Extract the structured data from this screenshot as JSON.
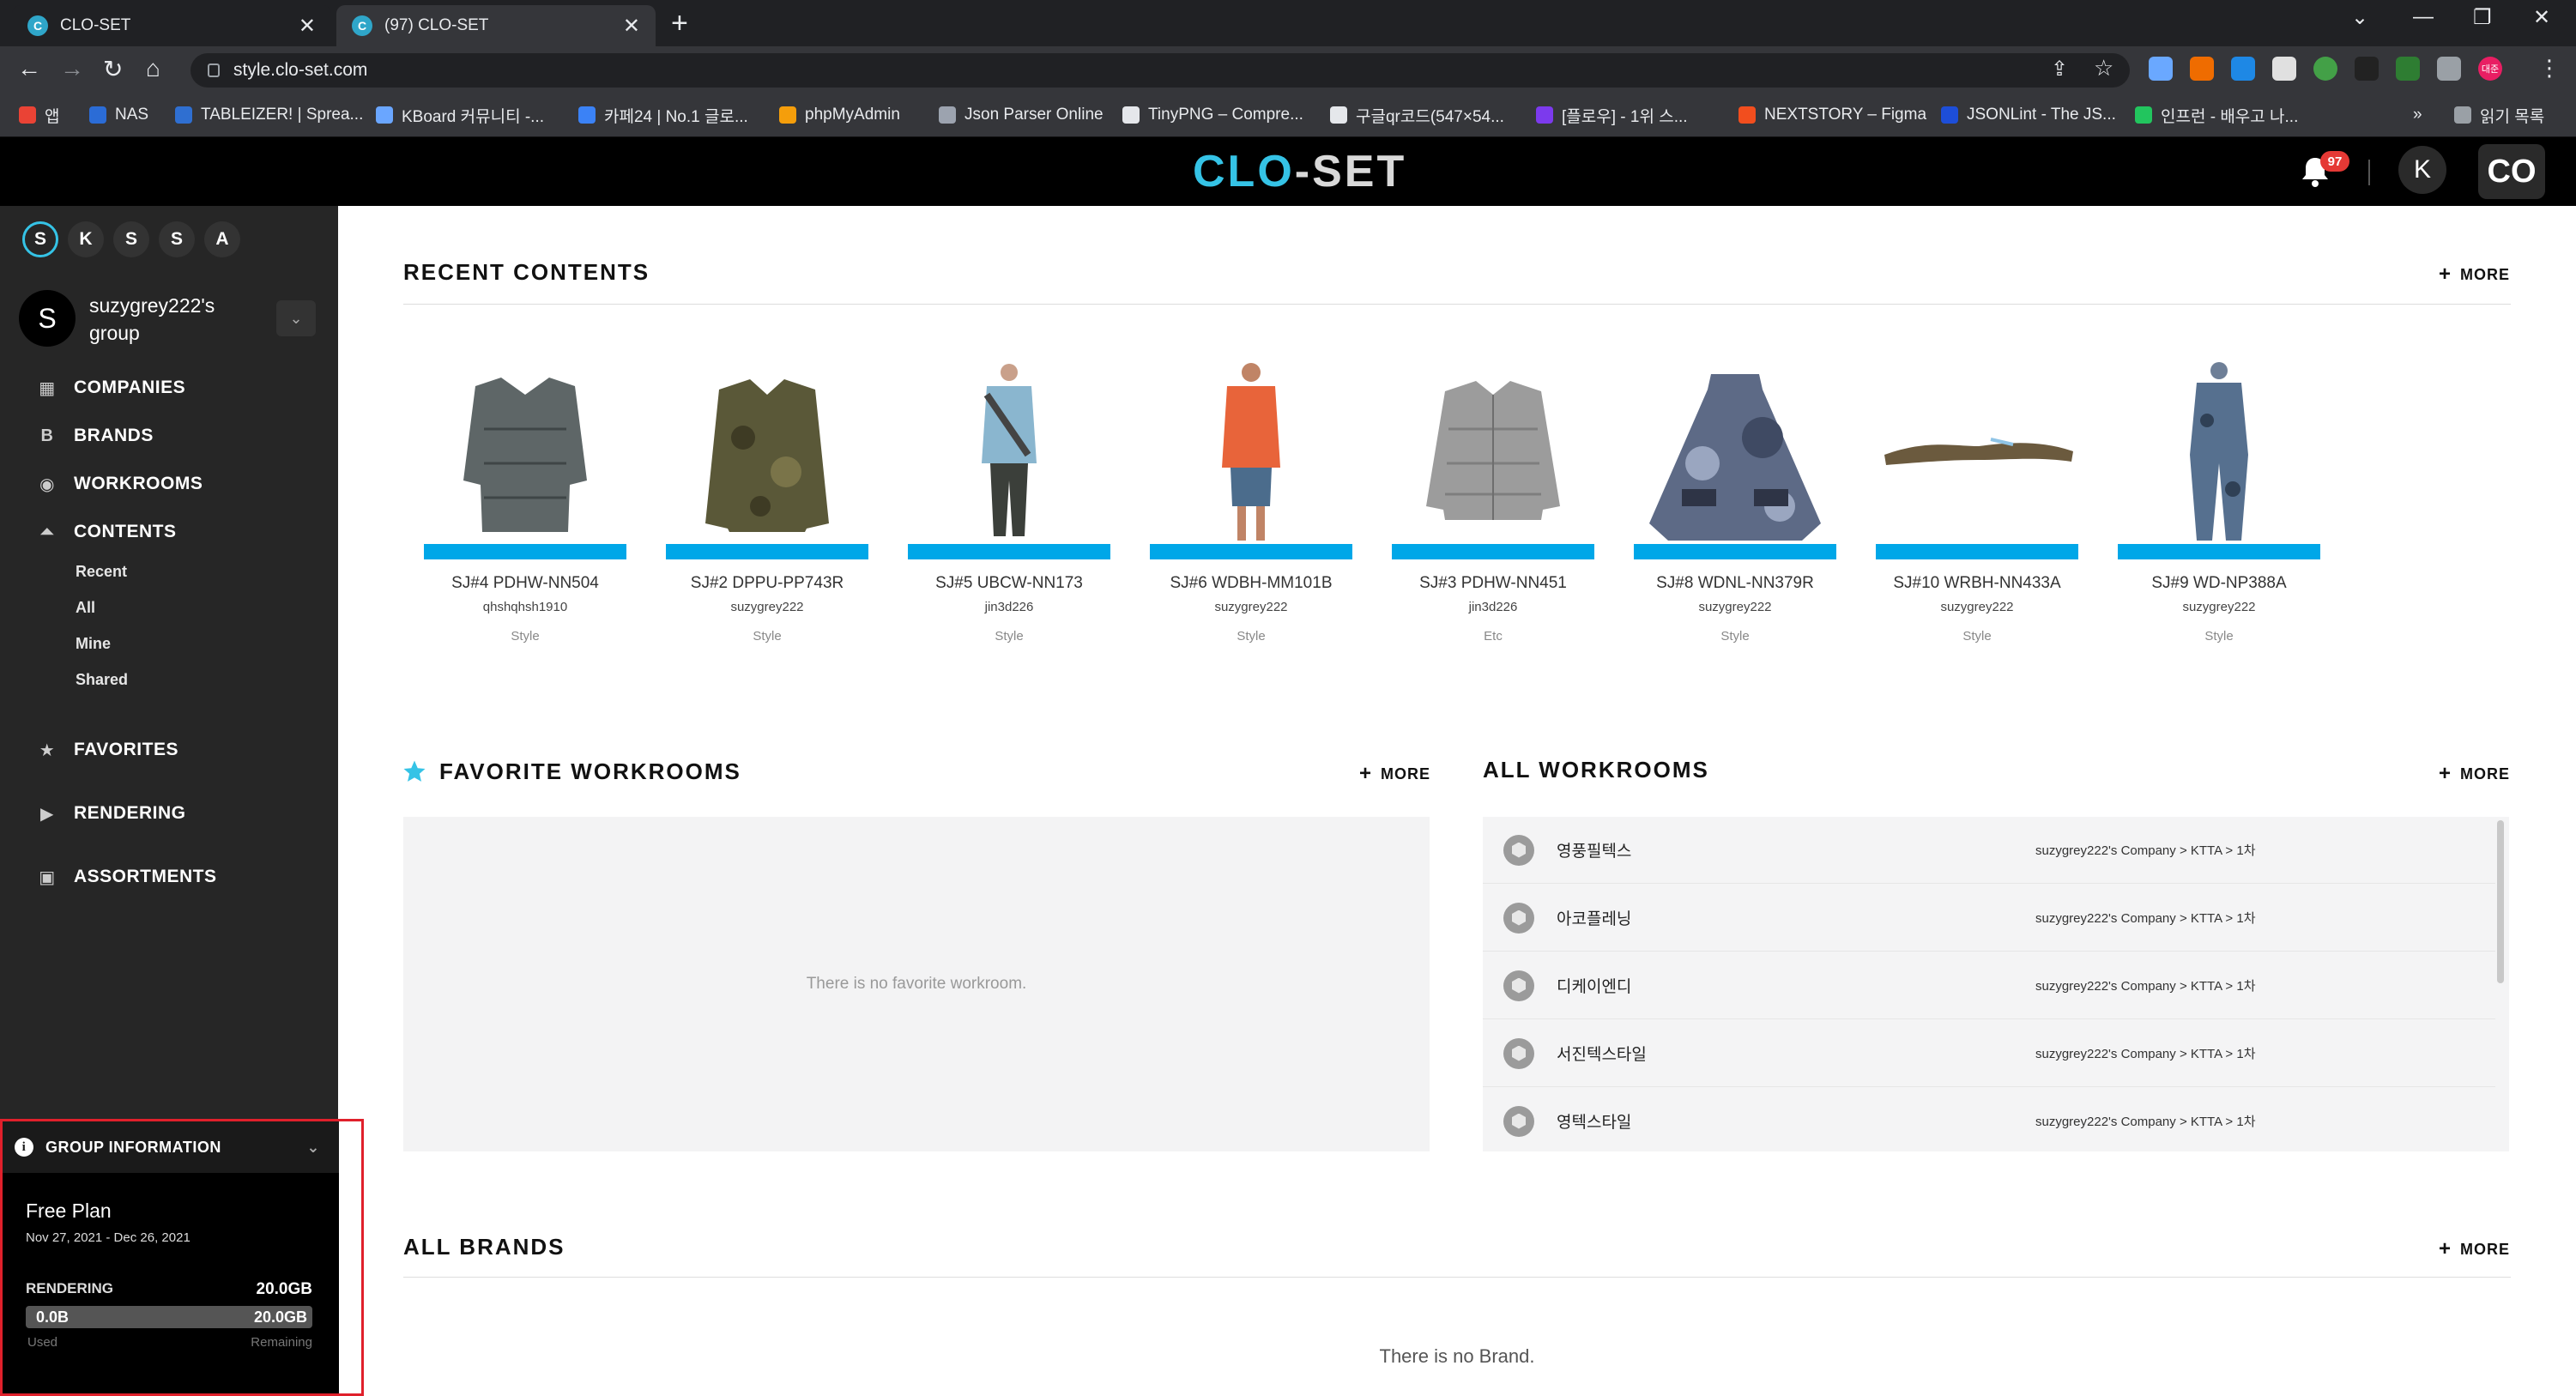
{
  "browser": {
    "tabs": [
      {
        "title": "CLO-SET",
        "favicon": "clo-set-logo"
      },
      {
        "title": "(97) CLO-SET",
        "favicon": "clo-set-logo"
      }
    ],
    "url": "style.clo-set.com",
    "bookmarks": [
      {
        "label": "앱",
        "color": "#ea4335"
      },
      {
        "label": "NAS",
        "color": "#2b6cd6"
      },
      {
        "label": "TABLEIZER! | Sprea...",
        "color": "#2f6fd1"
      },
      {
        "label": "KBoard 커뮤니티 -...",
        "color": "#6aa6ff"
      },
      {
        "label": "카페24 | No.1 글로...",
        "color": "#3b82f6"
      },
      {
        "label": "phpMyAdmin",
        "color": "#f59e0b"
      },
      {
        "label": "Json Parser Online",
        "color": "#9ca3af"
      },
      {
        "label": "TinyPNG – Compre...",
        "color": "#e5e7eb"
      },
      {
        "label": "구글qr코드(547×54...",
        "color": "#e5e7eb"
      },
      {
        "label": "[플로우] - 1위 스...",
        "color": "#7c3aed"
      },
      {
        "label": "NEXTSTORY – Figma",
        "color": "#f24e1e"
      },
      {
        "label": "JSONLint - The JS...",
        "color": "#1d4ed8"
      },
      {
        "label": "인프런 - 배우고 나...",
        "color": "#22c55e"
      }
    ],
    "bookmark_overflow": "»",
    "reading_list": "읽기 목록",
    "profile_label": "대준"
  },
  "header": {
    "logo_a": "CLO",
    "logo_b": "-SET",
    "notification_count": "97",
    "user_initial": "K",
    "app_icon": "CO"
  },
  "sidebar": {
    "groups": [
      "S",
      "K",
      "S",
      "S",
      "A"
    ],
    "active_group": 0,
    "group_initial": "S",
    "group_name": "suzygrey222's group",
    "nav": [
      {
        "label": "COMPANIES",
        "icon": "building-icon"
      },
      {
        "label": "BRANDS",
        "icon": "brand-icon"
      },
      {
        "label": "WORKROOMS",
        "icon": "workroom-icon"
      },
      {
        "label": "CONTENTS",
        "icon": "hanger-icon"
      }
    ],
    "contents_sub": [
      "Recent",
      "All",
      "Mine",
      "Shared"
    ],
    "nav2": [
      {
        "label": "FAVORITES",
        "icon": "star-icon"
      },
      {
        "label": "RENDERING",
        "icon": "camera-icon"
      },
      {
        "label": "ASSORTMENTS",
        "icon": "assortment-icon"
      }
    ]
  },
  "group_info": {
    "title": "GROUP INFORMATION",
    "plan": "Free Plan",
    "period": "Nov 27, 2021 - Dec 26, 2021",
    "rendering_label": "RENDERING",
    "rendering_total": "20.0GB",
    "used": "0.0B",
    "remaining": "20.0GB",
    "used_label": "Used",
    "remaining_label": "Remaining",
    "used_fraction": 0.0
  },
  "recent": {
    "title": "RECENT CONTENTS",
    "more": "MORE",
    "items": [
      {
        "name": "SJ#4 PDHW-NN504",
        "owner": "qhshqhsh1910",
        "type": "Style",
        "garment": "puffer",
        "color": "#5e6667"
      },
      {
        "name": "SJ#2 DPPU-PP743R",
        "owner": "suzygrey222",
        "type": "Style",
        "garment": "camo-jacket",
        "color": "#5a5838"
      },
      {
        "name": "SJ#5 UBCW-NN173",
        "owner": "jin3d226",
        "type": "Style",
        "garment": "figure-blue",
        "color": "#8ab6cf"
      },
      {
        "name": "SJ#6 WDBH-MM101B",
        "owner": "suzygrey222",
        "type": "Style",
        "garment": "figure-orange",
        "color": "#e8643a"
      },
      {
        "name": "SJ#3 PDHW-NN451",
        "owner": "jin3d226",
        "type": "Etc",
        "garment": "puffer-grey",
        "color": "#9c9c9c"
      },
      {
        "name": "SJ#8 WDNL-NN379R",
        "owner": "suzygrey222",
        "type": "Style",
        "garment": "poncho",
        "color": "#5d6a86"
      },
      {
        "name": "SJ#10 WRBH-NN433A",
        "owner": "suzygrey222",
        "type": "Style",
        "garment": "flat",
        "color": "#6b5a3e"
      },
      {
        "name": "SJ#9 WD-NP388A",
        "owner": "suzygrey222",
        "type": "Style",
        "garment": "jumpsuit",
        "color": "#56708f"
      }
    ]
  },
  "favorites": {
    "title": "FAVORITE WORKROOMS",
    "more": "MORE",
    "empty": "There is no favorite workroom."
  },
  "workrooms": {
    "title": "ALL WORKROOMS",
    "more": "MORE",
    "items": [
      {
        "name": "영풍필텍스",
        "path": "suzygrey222's Company > KTTA > 1차"
      },
      {
        "name": "아코플레닝",
        "path": "suzygrey222's Company > KTTA > 1차"
      },
      {
        "name": "디케이엔디",
        "path": "suzygrey222's Company > KTTA > 1차"
      },
      {
        "name": "서진텍스타일",
        "path": "suzygrey222's Company > KTTA > 1차"
      },
      {
        "name": "영텍스타일",
        "path": "suzygrey222's Company > KTTA > 1차"
      }
    ]
  },
  "brands": {
    "title": "ALL BRANDS",
    "more": "MORE",
    "empty": "There is no Brand."
  }
}
